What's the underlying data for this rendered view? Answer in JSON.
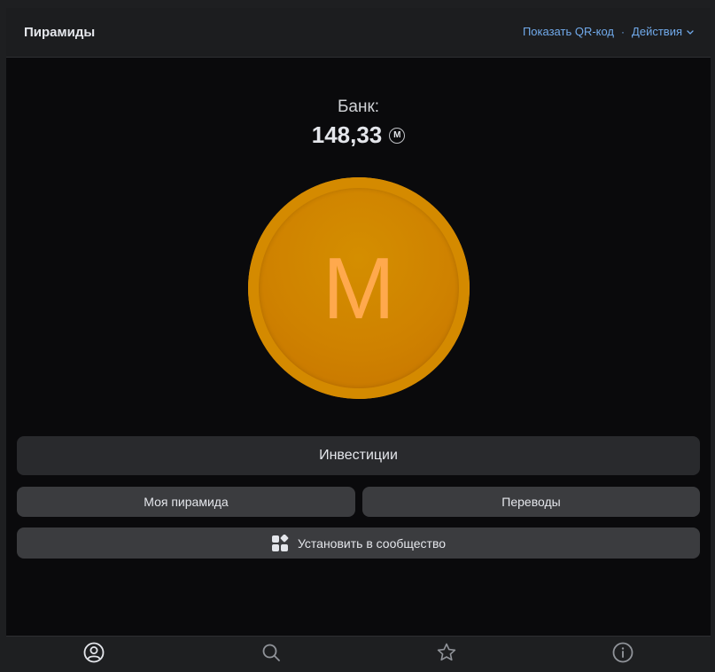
{
  "header": {
    "title": "Пирамиды",
    "qr_link": "Показать QR-код",
    "separator": "·",
    "actions_link": "Действия"
  },
  "bank": {
    "label": "Банк:",
    "amount": "148,33",
    "currency_letter": "M"
  },
  "coin": {
    "letter": "M",
    "colors": {
      "outer": "#d98800",
      "inner": "#cf8200",
      "letter": "#ffa94d"
    }
  },
  "buttons": {
    "investments": "Инвестиции",
    "my_pyramid": "Моя пирамида",
    "transfers": "Переводы",
    "install": "Установить в сообщество",
    "install_icon": "apps-icon"
  },
  "tabbar": {
    "tabs": [
      {
        "icon": "profile-icon",
        "active": true
      },
      {
        "icon": "search-icon",
        "active": false
      },
      {
        "icon": "star-icon",
        "active": false
      },
      {
        "icon": "info-icon",
        "active": false
      }
    ]
  },
  "colors": {
    "background": "#0a0a0c",
    "link": "#71aaeb",
    "button_primary": "#292a2d",
    "button_secondary": "#3b3c3f",
    "text": "#e4e6eb"
  }
}
